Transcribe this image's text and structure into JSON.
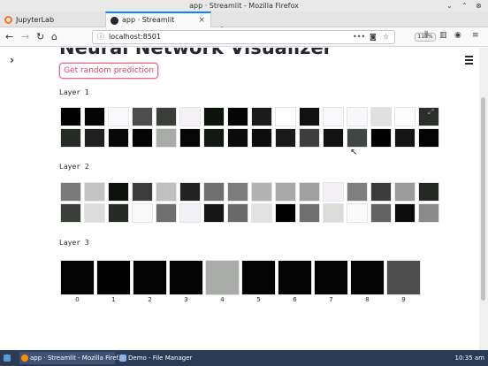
{
  "window": {
    "title": "app · Streamlit - Mozilla Firefox"
  },
  "tabs": [
    {
      "label": "JupyterLab",
      "icon": "jupyter-icon",
      "color": "#f37626"
    },
    {
      "label": "app · Streamlit",
      "icon": "streamlit-icon",
      "color": "#262730"
    }
  ],
  "url": {
    "value": "localhost:8501",
    "zoom": "110%"
  },
  "page": {
    "title": "Neural Network Visualizer",
    "button_label": "Get random prediction",
    "layers": [
      {
        "label": "Layer 1",
        "columns": 14,
        "cells": [
          "#000000",
          "#050505",
          "#f9f8fb",
          "#4d4d4d",
          "#3a3d3a",
          "#f4f2f6",
          "#0b130b",
          "#050505",
          "#1c1c1c",
          "#fefefe",
          "#111111",
          "#f9f8fb",
          "#f8f7fa",
          "#dfe0df",
          "#fcfcfc",
          "#2b2e2b",
          "#252b25",
          "#202020",
          "#070707",
          "#040404",
          "#a9aca9",
          "#060606",
          "#111711",
          "#0b0b0b",
          "#0c0c0c",
          "#1a1a1a",
          "#3e3e3e",
          "#121212",
          "#3f4743",
          "#020202",
          "#141414",
          "#030303"
        ]
      },
      {
        "label": "Layer 2",
        "columns": 14,
        "cells": [
          "#7a7a7a",
          "#c3c3c3",
          "#0d110d",
          "#3a3d3a",
          "#c1c1c1",
          "#222222",
          "#6f6f6f",
          "#7c7c7c",
          "#b3b3b3",
          "#a8a8a8",
          "#a0a0a0",
          "#f3f1f5",
          "#808080",
          "#393c39",
          "#9b9b9b",
          "#242824",
          "#3b403b",
          "#dcdcdc",
          "#262b26",
          "#f9f9f9",
          "#6f6f6f",
          "#f3f1f5",
          "#161616",
          "#6a6a6a",
          "#e3e3e3",
          "#000000",
          "#6f6f6f",
          "#d9dcd9",
          "#fafafa",
          "#626262",
          "#0c0c0c",
          "#8a8a8a"
        ]
      },
      {
        "label": "Layer 3",
        "columns": 10,
        "cells": [
          "#030303",
          "#020202",
          "#030303",
          "#030303",
          "#a9aca9",
          "#030303",
          "#030303",
          "#030303",
          "#030303",
          "#4d4d4d"
        ],
        "class_labels": [
          "0",
          "1",
          "2",
          "3",
          "4",
          "5",
          "6",
          "7",
          "8",
          "9"
        ]
      }
    ]
  },
  "taskbar": {
    "items": [
      {
        "label": "app · Streamlit - Mozilla Firef...",
        "active": true
      },
      {
        "label": "Demo - File Manager",
        "active": false
      }
    ],
    "clock": "10:35 am"
  }
}
